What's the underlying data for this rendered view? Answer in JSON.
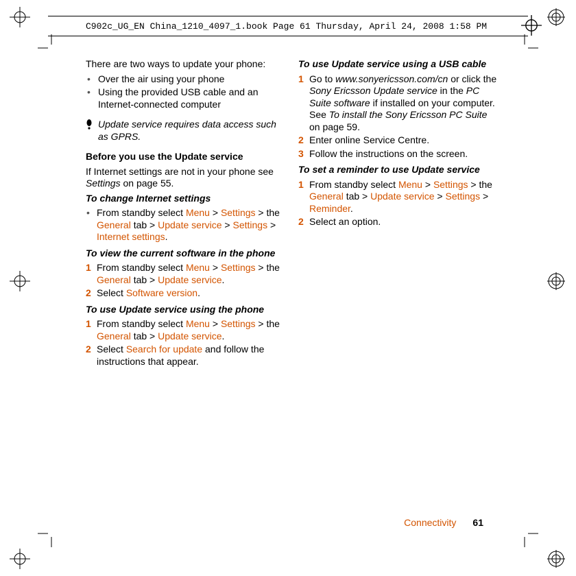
{
  "header": {
    "stamp": "C902c_UG_EN China_1210_4097_1.book  Page 61  Thursday, April 24, 2008  1:58 PM"
  },
  "left": {
    "intro": "There are two ways to update your phone:",
    "bullets": [
      "Over the air using your phone",
      "Using the provided USB cable and an Internet-connected computer"
    ],
    "note": "Update service requires data access such as GPRS.",
    "before_heading": "Before you use the Update service",
    "before_text1": "If Internet settings are not in your phone see ",
    "before_text_settings": "Settings",
    "before_text2": " on page 55.",
    "change_heading": "To change Internet settings",
    "change_step_pre": "From standby select ",
    "nav": {
      "menu": "Menu",
      "settings": "Settings",
      "general": "General",
      "update": "Update service",
      "settings2": "Settings",
      "internet": "Internet settings"
    },
    "tab_word": " tab > ",
    "the_word": " > the ",
    "gt": " > ",
    "dot": ".",
    "view_heading": "To view the current software in the phone",
    "view_step1_pre": "From standby select ",
    "view_step2_pre": "Select ",
    "software_version": "Software version"
  },
  "right": {
    "use_phone_heading": "To use Update service using the phone",
    "step1_pre": "From standby select ",
    "step2_pre": "Select ",
    "search_update": "Search for update",
    "step2_post": " and follow the instructions that appear.",
    "usb_heading": "To use Update service using a USB cable",
    "usb_step1_a": "Go to ",
    "usb_url": "www.sonyericsson.com/cn",
    "usb_step1_b": " or click the ",
    "usb_service": "Sony Ericsson Update service",
    "usb_step1_c": " in the ",
    "pc_suite": "PC Suite software",
    "usb_step1_d": " if installed on your computer. See ",
    "install_ref": "To install the Sony Ericsson PC Suite",
    "usb_step1_e": " on page 59.",
    "usb_step2": "Enter online Service Centre.",
    "usb_step3": "Follow the instructions on the screen.",
    "reminder_heading": "To set a reminder to use Update service",
    "reminder_step1_pre": "From standby select ",
    "reminder_nav_last": "Reminder",
    "reminder_step2": "Select an option."
  },
  "footer": {
    "section": "Connectivity",
    "page": "61"
  },
  "steps": {
    "n1": "1",
    "n2": "2",
    "n3": "3"
  }
}
